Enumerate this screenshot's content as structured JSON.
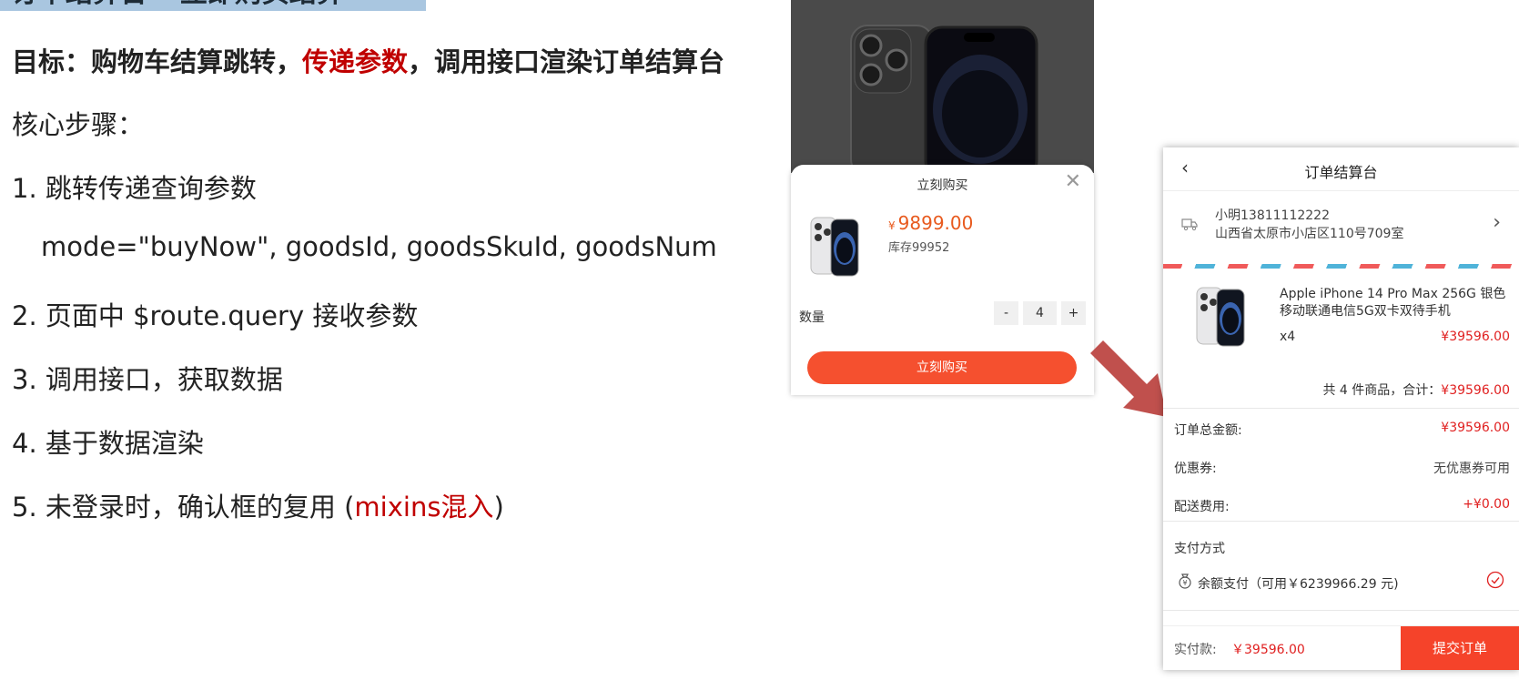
{
  "slide": {
    "title": "订单结算台 – 立即购买结算",
    "goal_prefix": "目标：购物车结算跳转，",
    "goal_highlight": "传递参数",
    "goal_suffix": "，调用接口渲染订单结算台",
    "steps_heading": "核心步骤：",
    "step1": "1. 跳转传递查询参数",
    "step1_params": "mode=\"buyNow\", goodsId, goodsSkuId, goodsNum",
    "step2": "2. 页面中 $route.query 接收参数",
    "step3": "3. 调用接口，获取数据",
    "step4": "4. 基于数据渲染",
    "step5_prefix": "5. 未登录时，确认框的复用 (",
    "step5_highlight": "mixins混入",
    "step5_suffix": ")"
  },
  "buy_sheet": {
    "title": "立刻购买",
    "close": "✕",
    "currency": "¥",
    "price": "9899.00",
    "stock": "库存99952",
    "qty_label": "数量",
    "minus": "-",
    "qty": "4",
    "plus": "+",
    "buy_button": "立刻购买"
  },
  "checkout": {
    "back": "‹",
    "title": "订单结算台",
    "contact": "小明13811112222",
    "address": "山西省太原市小店区110号709室",
    "addr_chevron": "›",
    "goods_name": "Apple iPhone 14 Pro Max 256G 银色 移动联通电信5G双卡双待手机",
    "goods_qty": "x4",
    "goods_price": "¥39596.00",
    "summary_prefix": "共 4 件商品，合计：",
    "summary_total": "¥39596.00",
    "total_label": "订单总金额:",
    "total_value": "¥39596.00",
    "coupon_label": "优惠券:",
    "coupon_value": "无优惠券可用",
    "shipping_label": "配送费用:",
    "shipping_value": "+¥0.00",
    "pay_heading": "支付方式",
    "pay_method": "余额支付（可用￥6239966.29 元)",
    "peek_text": "…",
    "footer_label": "实付款:",
    "footer_amount": "￥39596.00",
    "submit": "提交订单"
  },
  "colors": {
    "accent": "#f5502f",
    "price_red": "#e02020",
    "highlight_red": "#c00000"
  }
}
